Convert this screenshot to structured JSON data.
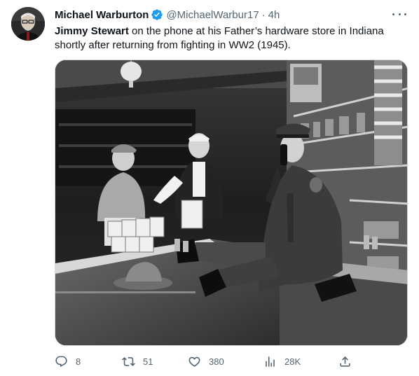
{
  "author": {
    "name": "Michael Warburton",
    "handle": "@MichaelWarbur17",
    "separator": "·",
    "time": "4h"
  },
  "tweet": {
    "text_bold": "Jimmy Stewart",
    "text_rest_line1": " on the phone at his Father’s hardware store in Indiana",
    "text_line2": "shortly after returning from fighting in WW2 (1945)."
  },
  "actions": {
    "replies": "8",
    "retweets": "51",
    "likes": "380",
    "views": "28K"
  },
  "colors": {
    "verified": "#1d9bf0",
    "secondary_text": "#536471"
  },
  "icons": [
    "verified-badge-icon",
    "more-icon",
    "reply-icon",
    "retweet-icon",
    "like-icon",
    "views-icon",
    "share-icon"
  ]
}
